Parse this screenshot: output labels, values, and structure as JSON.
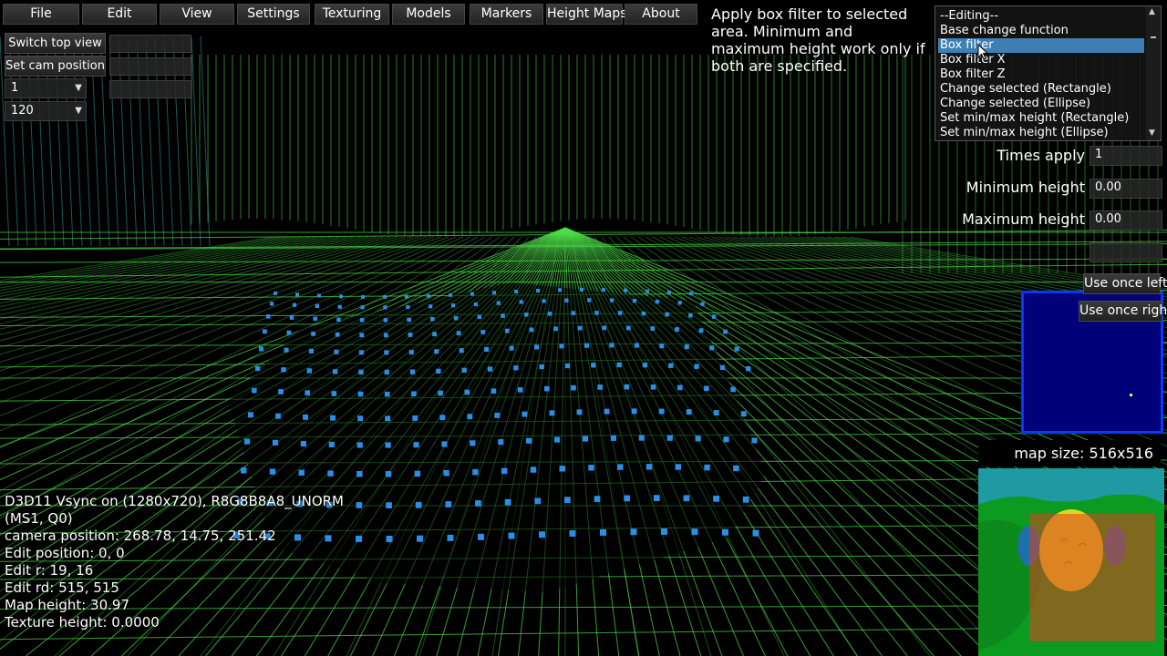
{
  "menu": {
    "file": "File",
    "edit": "Edit",
    "view": "View",
    "settings": "Settings",
    "texturing": "Texturing",
    "models": "Models",
    "markers": "Markers",
    "height_maps": "Height Maps",
    "about": "About"
  },
  "left_panel": {
    "switch_top_view": "Switch top view",
    "set_cam_position": "Set cam position",
    "combo1_value": "1",
    "combo2_value": "120"
  },
  "tooltip": "Apply box filter to selected area. Minimum and maximum height work only if both are specified.",
  "function_list": {
    "items": [
      "--Editing--",
      "Base change function",
      "Box filter",
      "Box filter X",
      "Box filter Z",
      "Change selected (Rectangle)",
      "Change selected (Ellipse)",
      "Set min/max height (Rectangle)",
      "Set min/max height (Ellipse)"
    ],
    "selected_index": 2
  },
  "params": {
    "times_apply_label": "Times apply",
    "times_apply_value": "1",
    "min_height_label": "Minimum height",
    "min_height_value": "0.00",
    "max_height_label": "Maximum height",
    "max_height_value": "0.00"
  },
  "buttons": {
    "use_once_left": "Use once left",
    "use_once_right": "Use once right"
  },
  "minimap": {
    "map_size": "map size: 516x516"
  },
  "info": {
    "line1": "D3D11 Vsync on (1280x720), R8G8B8A8_UNORM",
    "line2": "(MS1, Q0)",
    "line3": "camera position: 268.78, 14.75, 251.42",
    "line4": "Edit position: 0, 0",
    "line5": "Edit r: 19, 16",
    "line6": "Edit rd: 515, 515",
    "line7": "Map height: 30.97",
    "line8": "Texture height: 0.0000"
  },
  "colors": {
    "wireframe": "#4ee04a",
    "wireframe_cyan": "#3bc6c6",
    "selection_points": "#2a8ee8",
    "listbox_selected": "#3f7fb5",
    "minimap_blue": "#01017a",
    "minimap_border": "#0a36ff"
  }
}
